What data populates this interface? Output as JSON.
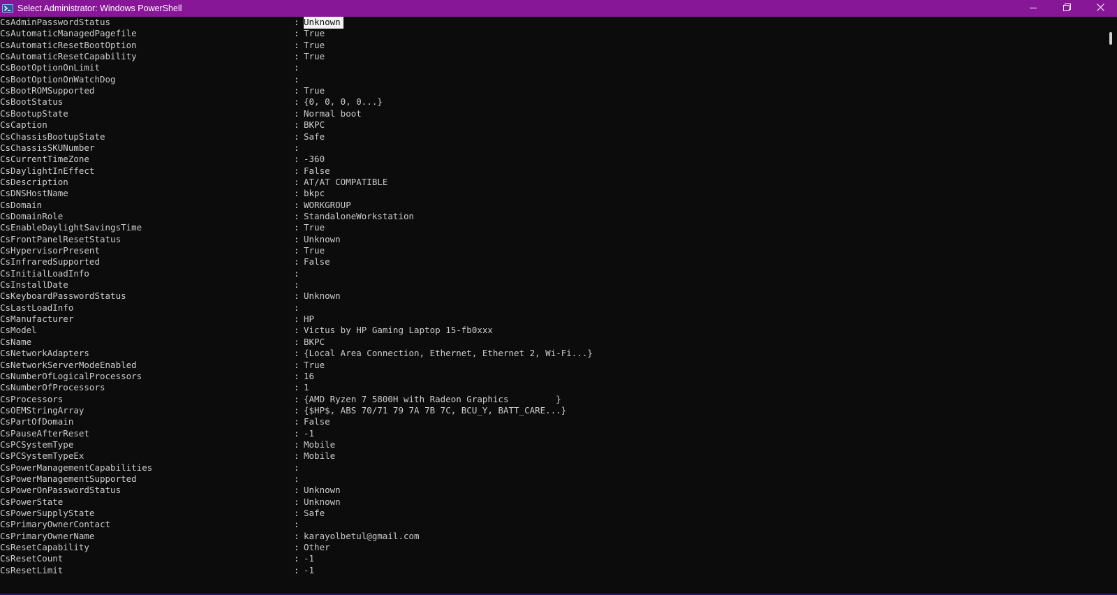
{
  "window": {
    "title": "Select Administrator: Windows PowerShell",
    "accent_color": "#881798",
    "icon": "powershell-icon",
    "controls": {
      "minimize_icon": "minimize-icon",
      "restore_icon": "restore-icon",
      "close_icon": "close-icon"
    }
  },
  "console": {
    "background": "#0c0c0c",
    "text_color": "#cccccc",
    "separator": ":",
    "selection": {
      "row": 0,
      "text": "Unknown"
    },
    "rows": [
      {
        "name": "CsAdminPasswordStatus",
        "value": "Unknown"
      },
      {
        "name": "CsAutomaticManagedPagefile",
        "value": "True"
      },
      {
        "name": "CsAutomaticResetBootOption",
        "value": "True"
      },
      {
        "name": "CsAutomaticResetCapability",
        "value": "True"
      },
      {
        "name": "CsBootOptionOnLimit",
        "value": ""
      },
      {
        "name": "CsBootOptionOnWatchDog",
        "value": ""
      },
      {
        "name": "CsBootROMSupported",
        "value": "True"
      },
      {
        "name": "CsBootStatus",
        "value": "{0, 0, 0, 0...}"
      },
      {
        "name": "CsBootupState",
        "value": "Normal boot"
      },
      {
        "name": "CsCaption",
        "value": "BKPC"
      },
      {
        "name": "CsChassisBootupState",
        "value": "Safe"
      },
      {
        "name": "CsChassisSKUNumber",
        "value": ""
      },
      {
        "name": "CsCurrentTimeZone",
        "value": "-360"
      },
      {
        "name": "CsDaylightInEffect",
        "value": "False"
      },
      {
        "name": "CsDescription",
        "value": "AT/AT COMPATIBLE"
      },
      {
        "name": "CsDNSHostName",
        "value": "bkpc"
      },
      {
        "name": "CsDomain",
        "value": "WORKGROUP"
      },
      {
        "name": "CsDomainRole",
        "value": "StandaloneWorkstation"
      },
      {
        "name": "CsEnableDaylightSavingsTime",
        "value": "True"
      },
      {
        "name": "CsFrontPanelResetStatus",
        "value": "Unknown"
      },
      {
        "name": "CsHypervisorPresent",
        "value": "True"
      },
      {
        "name": "CsInfraredSupported",
        "value": "False"
      },
      {
        "name": "CsInitialLoadInfo",
        "value": ""
      },
      {
        "name": "CsInstallDate",
        "value": ""
      },
      {
        "name": "CsKeyboardPasswordStatus",
        "value": "Unknown"
      },
      {
        "name": "CsLastLoadInfo",
        "value": ""
      },
      {
        "name": "CsManufacturer",
        "value": "HP"
      },
      {
        "name": "CsModel",
        "value": "Victus by HP Gaming Laptop 15-fb0xxx"
      },
      {
        "name": "CsName",
        "value": "BKPC"
      },
      {
        "name": "CsNetworkAdapters",
        "value": "{Local Area Connection, Ethernet, Ethernet 2, Wi-Fi...}"
      },
      {
        "name": "CsNetworkServerModeEnabled",
        "value": "True"
      },
      {
        "name": "CsNumberOfLogicalProcessors",
        "value": "16"
      },
      {
        "name": "CsNumberOfProcessors",
        "value": "1"
      },
      {
        "name": "CsProcessors",
        "value": "{AMD Ryzen 7 5800H with Radeon Graphics         }"
      },
      {
        "name": "CsOEMStringArray",
        "value": "{$HP$, ABS 70/71 79 7A 7B 7C, BCU_Y, BATT_CARE...}"
      },
      {
        "name": "CsPartOfDomain",
        "value": "False"
      },
      {
        "name": "CsPauseAfterReset",
        "value": "-1"
      },
      {
        "name": "CsPCSystemType",
        "value": "Mobile"
      },
      {
        "name": "CsPCSystemTypeEx",
        "value": "Mobile"
      },
      {
        "name": "CsPowerManagementCapabilities",
        "value": ""
      },
      {
        "name": "CsPowerManagementSupported",
        "value": ""
      },
      {
        "name": "CsPowerOnPasswordStatus",
        "value": "Unknown"
      },
      {
        "name": "CsPowerState",
        "value": "Unknown"
      },
      {
        "name": "CsPowerSupplyState",
        "value": "Safe"
      },
      {
        "name": "CsPrimaryOwnerContact",
        "value": ""
      },
      {
        "name": "CsPrimaryOwnerName",
        "value": "karayolbetul@gmail.com"
      },
      {
        "name": "CsResetCapability",
        "value": "Other"
      },
      {
        "name": "CsResetCount",
        "value": "-1"
      },
      {
        "name": "CsResetLimit",
        "value": "-1"
      }
    ]
  }
}
